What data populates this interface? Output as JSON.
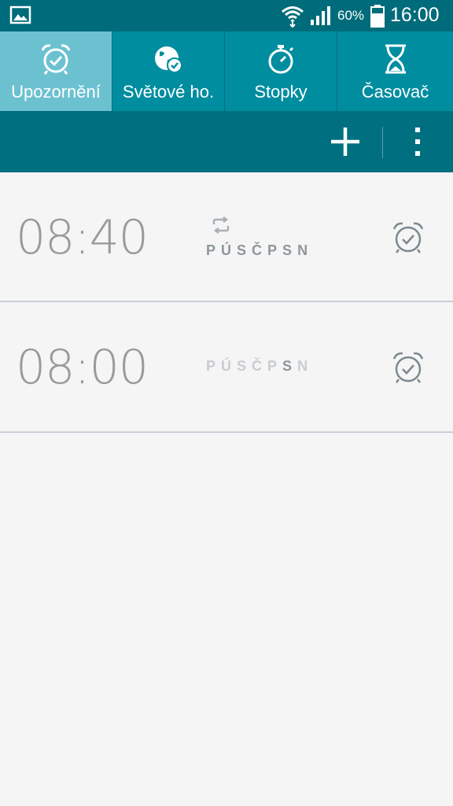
{
  "status_bar": {
    "battery_percent": "60%",
    "time": "16:00",
    "icons": [
      "gallery-icon",
      "wifi-icon",
      "signal-icon",
      "battery-icon"
    ]
  },
  "tabs": [
    {
      "label": "Upozornění",
      "icon": "alarm-clock-icon",
      "active": true
    },
    {
      "label": "Světové ho.",
      "icon": "world-clock-icon",
      "active": false
    },
    {
      "label": "Stopky",
      "icon": "stopwatch-icon",
      "active": false
    },
    {
      "label": "Časovač",
      "icon": "hourglass-icon",
      "active": false
    }
  ],
  "action_bar": {
    "add_icon": "plus-icon",
    "menu_icon": "more-vertical-icon"
  },
  "alarms": [
    {
      "time": "08:40",
      "repeat": true,
      "days": [
        "P",
        "Ú",
        "S",
        "Č",
        "P",
        "S",
        "N"
      ]
    },
    {
      "time": "08:00",
      "repeat": false,
      "days": [
        "P",
        "Ú",
        "S",
        "Č",
        "P",
        "S",
        "N"
      ],
      "highlighted_day": "S"
    }
  ],
  "colors": {
    "status_bar": "#006b7a",
    "tab_bar": "#008da0",
    "tab_active": "#6cc1d1",
    "action_bar": "#007080",
    "list_background": "#f5f5f5",
    "time_text": "#9a9a9a"
  }
}
